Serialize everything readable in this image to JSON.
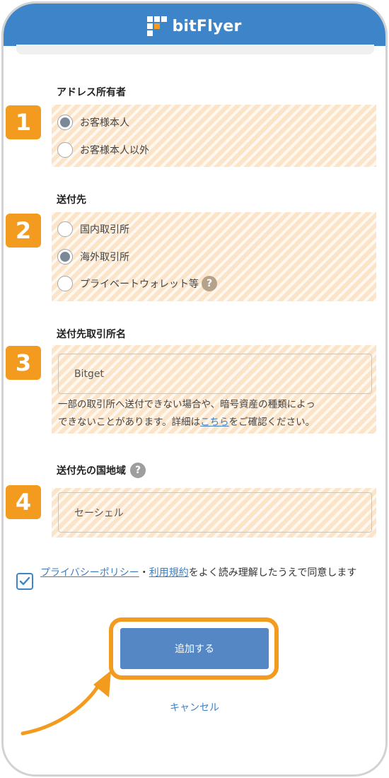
{
  "header": {
    "brand": "bitFlyer"
  },
  "owner_section": {
    "label": "アドレス所有者",
    "badge": "1",
    "options": [
      {
        "label": "お客様本人",
        "selected": true
      },
      {
        "label": "お客様本人以外",
        "selected": false
      }
    ]
  },
  "destination_section": {
    "label": "送付先",
    "badge": "2",
    "options": [
      {
        "label": "国内取引所",
        "selected": false
      },
      {
        "label": "海外取引所",
        "selected": true
      },
      {
        "label": "プライベートウォレット等",
        "selected": false
      }
    ],
    "help_icon": "?"
  },
  "exchange_section": {
    "label": "送付先取引所名",
    "badge": "3",
    "value": "Bitget",
    "note_line1": "一部の取引所へ送付できない場合や、暗号資産の種類によっ",
    "note_line2_pre": "できないことがあります。詳細は",
    "note_link": "こちら",
    "note_line2_post": "をご確認ください。"
  },
  "country_section": {
    "label": "送付先の国地域",
    "badge": "4",
    "value": "セーシェル",
    "help_icon": "?"
  },
  "agreement": {
    "checked": true,
    "privacy_link": "プライバシーポリシー",
    "separator": "・",
    "terms_link": "利用規約",
    "text": "をよく読み理解したうえで同意します"
  },
  "actions": {
    "add_label": "追加する",
    "cancel_label": "キャンセル"
  },
  "colors": {
    "header": "#3d84c9",
    "accent_orange": "#f29b1f",
    "button": "#5587c4",
    "link": "#3d7fc1"
  }
}
